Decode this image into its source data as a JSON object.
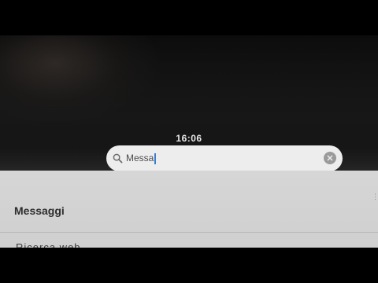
{
  "status_bar": {
    "time": "16:06"
  },
  "search": {
    "value": "Messa",
    "icon": "search-icon",
    "clear_icon": "clear-icon"
  },
  "results": {
    "section_title": "Messaggi",
    "next_item": "Ricerca web"
  },
  "colors": {
    "search_field": "#ededed",
    "results_background": "#d6d6d6",
    "cursor": "#3a7bd5"
  }
}
